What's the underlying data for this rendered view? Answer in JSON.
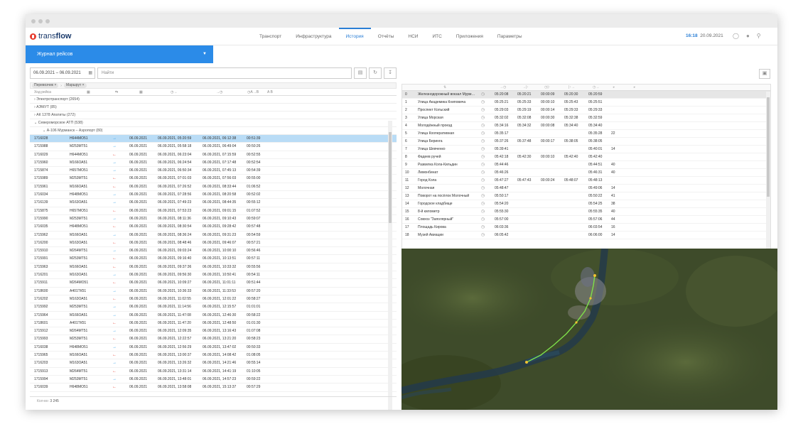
{
  "app": {
    "brand_light": "trans",
    "brand_bold": "flow",
    "menu": [
      "Транспорт",
      "Инфраструктура",
      "История",
      "Отчёты",
      "НСИ",
      "ИТС",
      "Приложения",
      "Параметры"
    ],
    "active_menu": "История",
    "time": "16:18",
    "date": "20.09.2021"
  },
  "journal": {
    "title": "Журнал рейсов"
  },
  "filters": {
    "date_range": "06.09.2021 – 06.09.2021",
    "search_placeholder": "Найти",
    "tags": [
      "Перевозчик",
      "Маршрут"
    ]
  },
  "table": {
    "header_first": "Ход рейса",
    "groups": [
      "Электротранспорт (2654)",
      "АЭМУТ (85)",
      "АК 1378 Апатиты (272)",
      "Североморское АТП (538)"
    ],
    "subgroup": "А-106 Мурманск – Аэропорт (80)",
    "rows": [
      [
        "1716028",
        "Н644МО51",
        "→",
        "06.09.2021",
        "06.09.2021, 05:20:59",
        "06.09.2021, 06:12:38",
        "00:51:39"
      ],
      [
        "1715988",
        "М253МТ51",
        "→",
        "06.09.2021",
        "06.09.2021, 05:58:18",
        "06.09.2021, 06:49:04",
        "00:50:26"
      ],
      [
        "1716029",
        "Н644МО51",
        "←",
        "06.09.2021",
        "06.09.2021, 06:23:04",
        "06.09.2021, 07:15:59",
        "00:52:55"
      ],
      [
        "1715960",
        "М166ОА51",
        "→",
        "06.09.2021",
        "06.09.2021, 06:24:54",
        "06.09.2021, 07:17:48",
        "00:52:54"
      ],
      [
        "1715874",
        "Н657МО51",
        "→",
        "06.09.2021",
        "06.09.2021, 06:50:34",
        "06.09.2021, 07:45:13",
        "00:54:39"
      ],
      [
        "1715989",
        "М253МТ51",
        "←",
        "06.09.2021",
        "06.09.2021, 07:01:03",
        "06.09.2021, 07:56:03",
        "00:55:00"
      ],
      [
        "1715961",
        "М166ОА51",
        "←",
        "06.09.2021",
        "06.09.2021, 07:26:52",
        "06.09.2021, 08:33:44",
        "01:06:52"
      ],
      [
        "1716034",
        "Н648МО51",
        "→",
        "06.09.2021",
        "06.09.2021, 07:28:56",
        "06.09.2021, 08:20:58",
        "00:52:02"
      ],
      [
        "1716139",
        "М163ОА51",
        "→",
        "06.09.2021",
        "06.09.2021, 07:49:23",
        "06.09.2021, 08:44:35",
        "00:55:12"
      ],
      [
        "1715875",
        "Н657МО51",
        "←",
        "06.09.2021",
        "06.09.2021, 07:53:23",
        "06.09.2021, 09:01:15",
        "01:07:52"
      ],
      [
        "1715990",
        "М253МТ51",
        "→",
        "06.09.2021",
        "06.09.2021, 08:11:36",
        "06.09.2021, 09:10:43",
        "00:59:07"
      ],
      [
        "1716035",
        "Н648МО51",
        "←",
        "06.09.2021",
        "06.09.2021, 08:30:54",
        "06.09.2021, 09:28:42",
        "00:57:48"
      ],
      [
        "1715962",
        "М166ОА51",
        "→",
        "06.09.2021",
        "06.09.2021, 08:36:24",
        "06.09.2021, 09:31:23",
        "00:54:59"
      ],
      [
        "1716200",
        "М163ОА51",
        "←",
        "06.09.2021",
        "06.09.2021, 08:48:46",
        "06.09.2021, 09:46:07",
        "00:57:21"
      ],
      [
        "1715910",
        "М264МТ51",
        "→",
        "06.09.2021",
        "06.09.2021, 09:03:24",
        "06.09.2021, 10:00:10",
        "00:56:46"
      ],
      [
        "1715991",
        "М253МТ51",
        "←",
        "06.09.2021",
        "06.09.2021, 09:16:40",
        "06.09.2021, 10:13:51",
        "00:57:11"
      ],
      [
        "1715963",
        "М166ОА51",
        "←",
        "06.09.2021",
        "06.09.2021, 09:37:36",
        "06.09.2021, 10:33:32",
        "00:55:56"
      ],
      [
        "1716201",
        "М163ОА51",
        "→",
        "06.09.2021",
        "06.09.2021, 09:56:30",
        "06.09.2021, 10:50:41",
        "00:54:11"
      ],
      [
        "1715911",
        "М264МО51",
        "←",
        "06.09.2021",
        "06.09.2021, 10:09:27",
        "06.09.2021, 11:01:11",
        "00:51:44"
      ],
      [
        "1718600",
        "А401ТК51",
        "→",
        "06.09.2021",
        "06.09.2021, 10:36:33",
        "06.09.2021, 11:33:53",
        "00:57:20"
      ],
      [
        "1716202",
        "М163ОА51",
        "←",
        "06.09.2021",
        "06.09.2021, 11:02:55",
        "06.09.2021, 12:01:22",
        "00:58:27"
      ],
      [
        "1715992",
        "М253МТ51",
        "→",
        "06.09.2021",
        "06.09.2021, 11:14:56",
        "06.09.2021, 12:15:57",
        "01:01:01"
      ],
      [
        "1715964",
        "М166ОА51",
        "→",
        "06.09.2021",
        "06.09.2021, 11:47:08",
        "06.09.2021, 12:46:30",
        "00:58:22"
      ],
      [
        "1718601",
        "А401ТК51",
        "←",
        "06.09.2021",
        "06.09.2021, 11:47:20",
        "06.09.2021, 12:48:50",
        "01:01:30"
      ],
      [
        "1715912",
        "М264МТ51",
        "→",
        "06.09.2021",
        "06.09.2021, 12:09:35",
        "06.09.2021, 13:16:43",
        "01:07:08"
      ],
      [
        "1715993",
        "М253МТ51",
        "←",
        "06.09.2021",
        "06.09.2021, 12:22:57",
        "06.09.2021, 13:21:20",
        "00:58:23"
      ],
      [
        "1716038",
        "Н648МО51",
        "→",
        "06.09.2021",
        "06.09.2021, 12:56:29",
        "06.09.2021, 13:47:02",
        "00:50:33"
      ],
      [
        "1715965",
        "М166ОА51",
        "←",
        "06.09.2021",
        "06.09.2021, 13:00:37",
        "06.09.2021, 14:08:42",
        "01:08:05"
      ],
      [
        "1716203",
        "М163ОА51",
        "→",
        "06.09.2021",
        "06.09.2021, 13:26:32",
        "06.09.2021, 14:21:46",
        "00:55:14"
      ],
      [
        "1715913",
        "М264МТ51",
        "←",
        "06.09.2021",
        "06.09.2021, 13:31:14",
        "06.09.2021, 14:41:19",
        "01:10:05"
      ],
      [
        "1715994",
        "М253МТ51",
        "→",
        "06.09.2021",
        "06.09.2021, 13:48:01",
        "06.09.2021, 14:57:23",
        "00:59:22"
      ],
      [
        "1716039",
        "Н648МО51",
        "←",
        "06.09.2021",
        "06.09.2021, 13:58:08",
        "06.09.2021, 15:13:37",
        "00:57:29"
      ]
    ],
    "count_label": "Кол-во:",
    "count": "3 245"
  },
  "stops": {
    "rows": [
      [
        "0",
        "Железнодорожный вокзал Мурм…",
        "05:20:08",
        "05:20:21",
        "00:00:09",
        "05:20:30",
        "05:20:59",
        ""
      ],
      [
        "1",
        "Улица Академика Книповича",
        "05:25:21",
        "05:25:33",
        "00:00:10",
        "05:25:43",
        "05:25:51",
        ""
      ],
      [
        "2",
        "Проспект Кольский",
        "05:29:03",
        "05:29:19",
        "00:00:14",
        "05:29:33",
        "05:29:33",
        ""
      ],
      [
        "3",
        "Улица Морская",
        "05:32:02",
        "05:32:08",
        "00:00:30",
        "05:32:38",
        "05:32:59",
        ""
      ],
      [
        "4",
        "Молодёжный проезд",
        "05:34:16",
        "05:34:32",
        "00:00:08",
        "05:34:40",
        "05:34:40",
        ""
      ],
      [
        "5",
        "Улица Кооперативная",
        "05:35:17",
        "",
        "",
        "",
        "05:35:28",
        "22"
      ],
      [
        "6",
        "Улица Беринга",
        "05:37:26",
        "05:37:48",
        "00:00:17",
        "05:38:05",
        "05:38:05",
        ""
      ],
      [
        "7",
        "Улица Шевченко",
        "05:39:41",
        "",
        "",
        "",
        "05:40:01",
        "14"
      ],
      [
        "8",
        "Фадеев ручей",
        "05:42:18",
        "05:42:30",
        "00:00:10",
        "05:42:40",
        "05:42:40",
        ""
      ],
      [
        "9",
        "Развилка Кола-Кильдин",
        "05:44:46",
        "",
        "",
        "",
        "05:44:51",
        "40"
      ],
      [
        "10",
        "Лимонбинат",
        "05:46:26",
        "",
        "",
        "",
        "05:46:31",
        "40"
      ],
      [
        "11",
        "Город Кола",
        "05:47:27",
        "05:47:43",
        "00:00:24",
        "05:48:07",
        "05:48:13",
        ""
      ],
      [
        "12",
        "Молочная",
        "05:48:47",
        "",
        "",
        "",
        "05:49:06",
        "14"
      ],
      [
        "13",
        "Поворот на посёлок Молочный",
        "05:50:17",
        "",
        "",
        "",
        "05:50:22",
        "41"
      ],
      [
        "14",
        "Городское кладбище",
        "05:54:20",
        "",
        "",
        "",
        "05:54:25",
        "38"
      ],
      [
        "15",
        "8-й километр",
        "05:55:30",
        "",
        "",
        "",
        "05:55:35",
        "40"
      ],
      [
        "16",
        "Совхоз \"Заполярный\"",
        "05:57:00",
        "",
        "",
        "",
        "05:57:06",
        "44"
      ],
      [
        "17",
        "Площадь Кирова",
        "06:03:36",
        "",
        "",
        "",
        "06:03:54",
        "16"
      ],
      [
        "18",
        "Музей Авиации",
        "06:05:42",
        "",
        "",
        "",
        "06:06:00",
        "14"
      ]
    ]
  },
  "colors": {
    "accent": "#2b8be8",
    "brand_red": "#e63c2f",
    "route": "#7ee04a"
  }
}
